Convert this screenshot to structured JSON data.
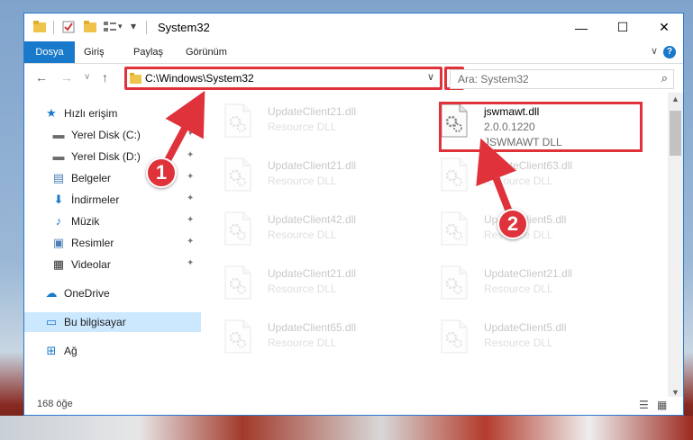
{
  "window": {
    "title": "System32",
    "min_glyph": "—",
    "max_glyph": "☐",
    "close_glyph": "✕"
  },
  "ribbon": {
    "tabs": [
      "Dosya",
      "Giriş",
      "Paylaş",
      "Görünüm"
    ],
    "expand_glyph": "∨",
    "help_glyph": "?"
  },
  "nav": {
    "back_glyph": "←",
    "forward_glyph": "→",
    "recent_glyph": "∨",
    "up_glyph": "↑",
    "address": "C:\\Windows\\System32",
    "address_drop_glyph": "∨",
    "refresh_glyph": "↻",
    "search_placeholder": "Ara: System32",
    "search_glyph": "⌕"
  },
  "sidebar": {
    "items": [
      {
        "label": "Hızlı erişim",
        "icon": "star-icon",
        "glyph": "★",
        "color": "#1979ca",
        "pinned": false
      },
      {
        "label": "Yerel Disk (C:)",
        "icon": "drive-icon",
        "glyph": "▬",
        "color": "#6d6d6d",
        "pinned": true
      },
      {
        "label": "Yerel Disk (D:)",
        "icon": "drive-icon",
        "glyph": "▬",
        "color": "#6d6d6d",
        "pinned": true
      },
      {
        "label": "Belgeler",
        "icon": "documents-icon",
        "glyph": "▤",
        "color": "#4a7fb5",
        "pinned": true
      },
      {
        "label": "İndirmeler",
        "icon": "download-icon",
        "glyph": "⬇",
        "color": "#1979ca",
        "pinned": true
      },
      {
        "label": "Müzik",
        "icon": "music-icon",
        "glyph": "♪",
        "color": "#1979ca",
        "pinned": true
      },
      {
        "label": "Resimler",
        "icon": "pictures-icon",
        "glyph": "▣",
        "color": "#4a7fb5",
        "pinned": true
      },
      {
        "label": "Videolar",
        "icon": "videos-icon",
        "glyph": "▦",
        "color": "#333333",
        "pinned": true
      },
      {
        "label": "OneDrive",
        "icon": "cloud-icon",
        "glyph": "☁",
        "color": "#1979ca",
        "pinned": false
      },
      {
        "label": "Bu bilgisayar",
        "icon": "computer-icon",
        "glyph": "▭",
        "color": "#1979ca",
        "pinned": false
      },
      {
        "label": "Ağ",
        "icon": "network-icon",
        "glyph": "⊞",
        "color": "#1979ca",
        "pinned": false
      }
    ],
    "pin_glyph": "✦"
  },
  "files": [
    {
      "name": "UpdateClient21.dll",
      "sub1": "Resource DLL",
      "sub2": "",
      "faded": true
    },
    {
      "name": "jswmawt.dll",
      "sub1": "2.0.0.1220",
      "sub2": "JSWMAWT DLL",
      "faded": false
    },
    {
      "name": "UpdateClient21.dll",
      "sub1": "Resource DLL",
      "sub2": "",
      "faded": true
    },
    {
      "name": "UpdateClient63.dll",
      "sub1": "Resource DLL",
      "sub2": "",
      "faded": true
    },
    {
      "name": "UpdateClient42.dll",
      "sub1": "Resource DLL",
      "sub2": "",
      "faded": true
    },
    {
      "name": "UpdateClient5.dll",
      "sub1": "Resource DLL",
      "sub2": "",
      "faded": true
    },
    {
      "name": "UpdateClient21.dll",
      "sub1": "Resource DLL",
      "sub2": "",
      "faded": true
    },
    {
      "name": "UpdateClient21.dll",
      "sub1": "Resource DLL",
      "sub2": "",
      "faded": true
    },
    {
      "name": "UpdateClient65.dll",
      "sub1": "Resource DLL",
      "sub2": "",
      "faded": true
    },
    {
      "name": "UpdateClient5.dll",
      "sub1": "Resource DLL",
      "sub2": "",
      "faded": true
    }
  ],
  "status": {
    "count": "168 öğe",
    "details_view_glyph": "☰",
    "icons_view_glyph": "▦"
  },
  "scroll": {
    "up_glyph": "▲",
    "down_glyph": "▼"
  },
  "markers": {
    "one": "1",
    "two": "2"
  },
  "colors": {
    "accent": "#1979ca",
    "annotation": "#e0323b"
  }
}
